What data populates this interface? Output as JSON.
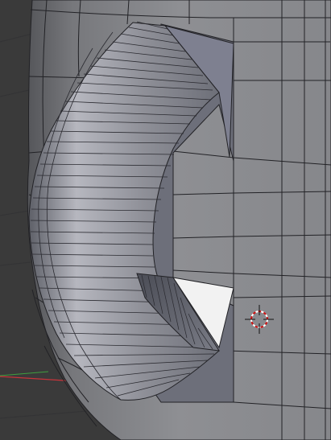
{
  "viewport": {
    "background_color": "#3a3a3a",
    "mesh_face_color": "#8d8e92",
    "mesh_edge_color": "#222226",
    "tube_outer_color": "#9fa0a8",
    "tube_inner_color": "#666872",
    "hole_color": "#f2f2f2",
    "x_axis_color": "#c8343a",
    "y_axis_color": "#3f9f3f",
    "cursor_ring_colors": [
      "#d01010",
      "#ffffff"
    ],
    "icons": [
      "3d-cursor-icon"
    ]
  }
}
